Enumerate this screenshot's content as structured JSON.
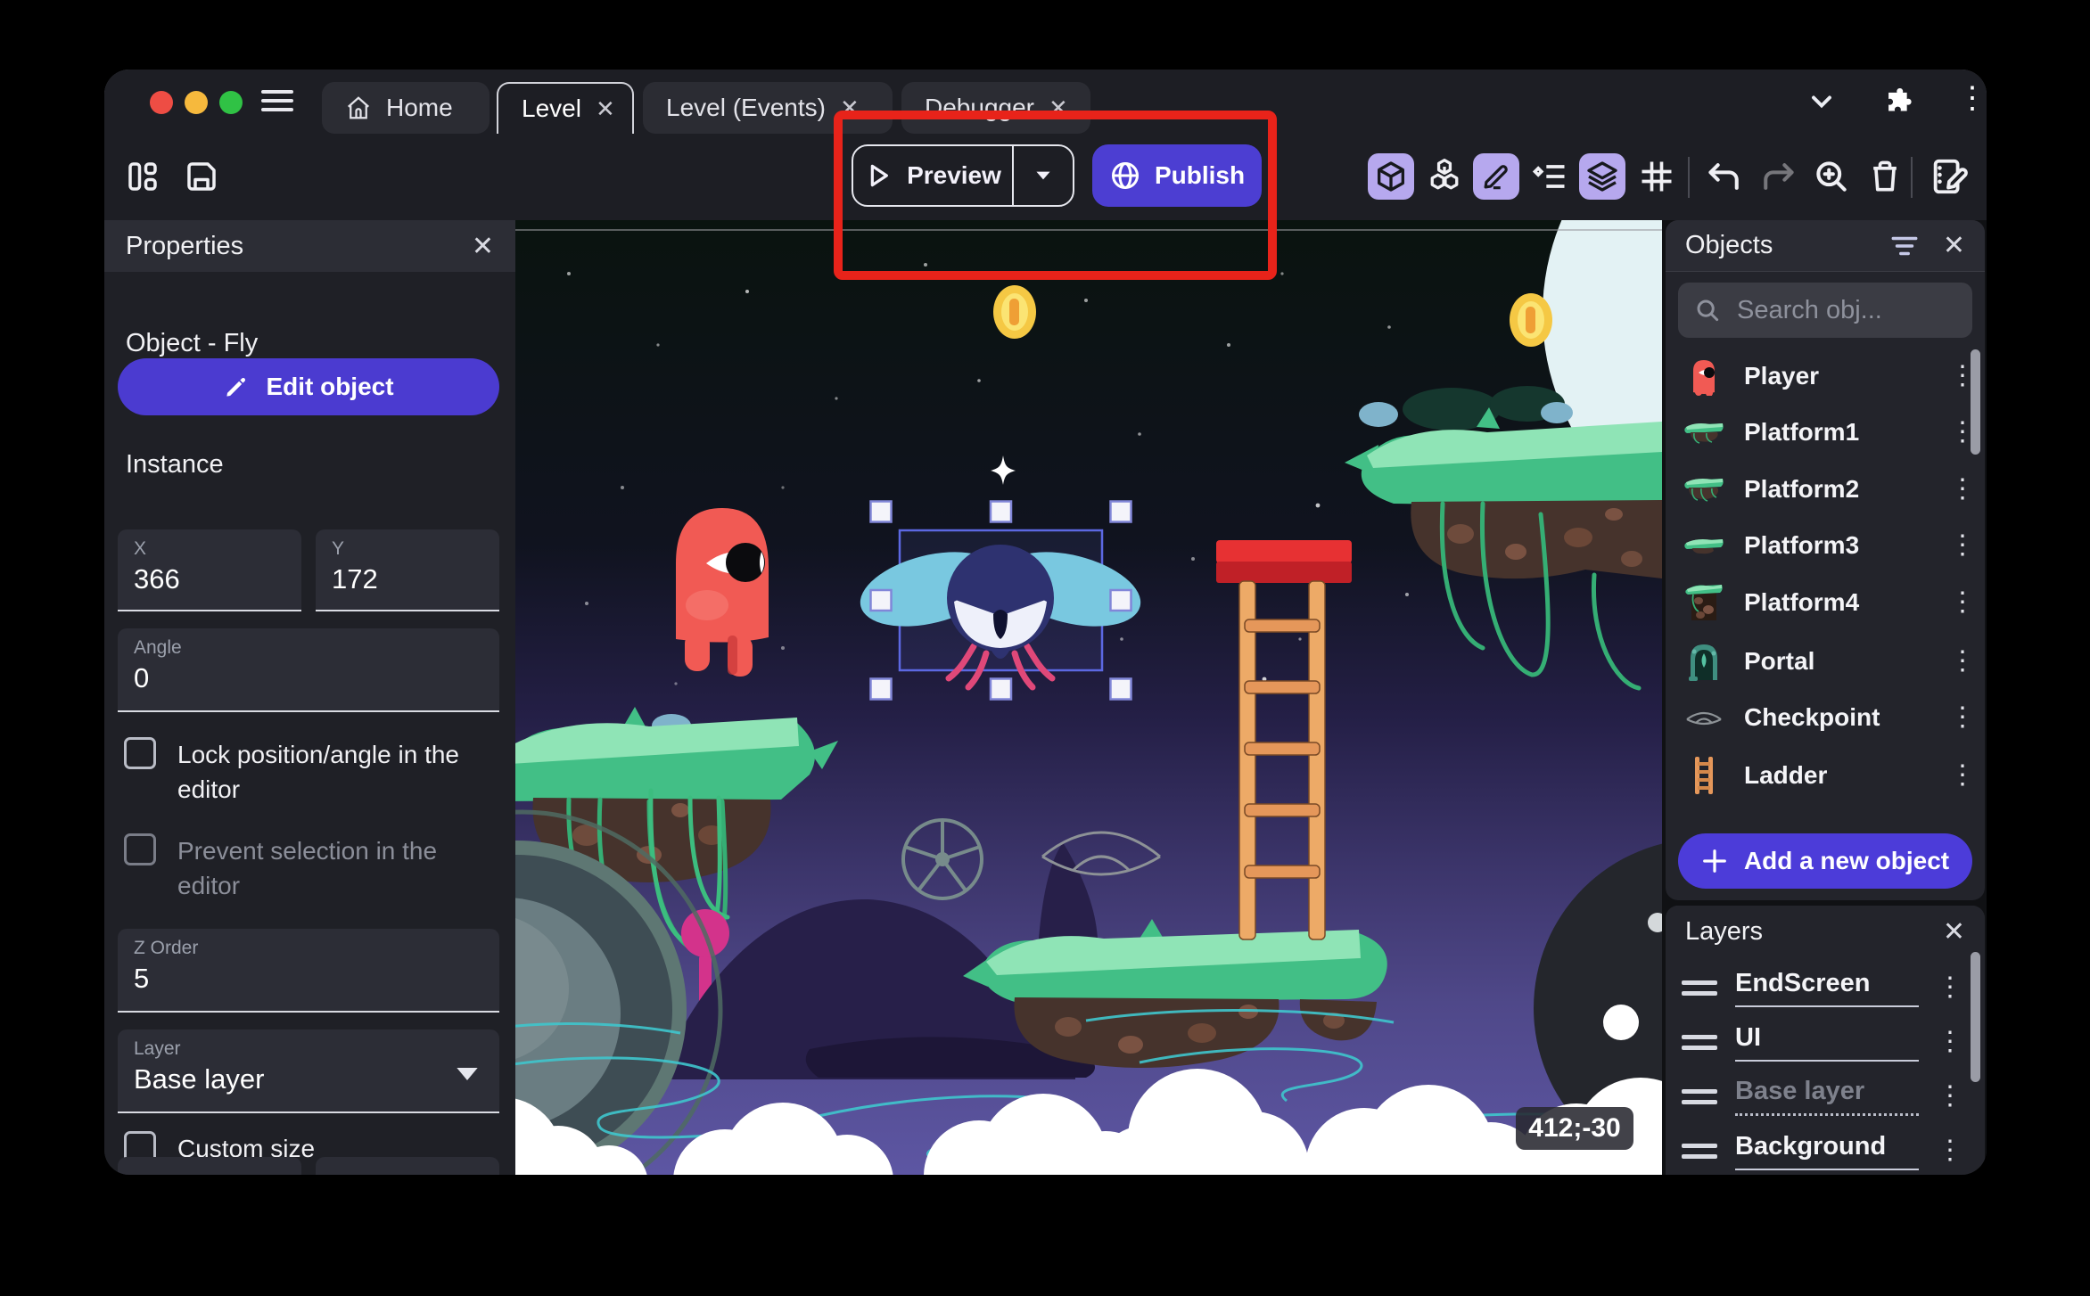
{
  "window": {
    "tabs": [
      {
        "label": "Home"
      },
      {
        "label": "Level"
      },
      {
        "label": "Level (Events)"
      },
      {
        "label": "Debugger"
      }
    ]
  },
  "toolbar": {
    "preview_label": "Preview",
    "publish_label": "Publish"
  },
  "properties": {
    "title": "Properties",
    "object_heading": "Object - Fly",
    "edit_object_label": "Edit object",
    "instance_heading": "Instance",
    "fields": {
      "x": {
        "label": "X",
        "value": "366"
      },
      "y": {
        "label": "Y",
        "value": "172"
      },
      "angle": {
        "label": "Angle",
        "value": "0"
      },
      "z_order": {
        "label": "Z Order",
        "value": "5"
      },
      "layer": {
        "label": "Layer",
        "value": "Base layer"
      }
    },
    "checkboxes": {
      "lock_label": "Lock position/angle in the editor",
      "prevent_label": "Prevent selection in the editor",
      "custom_size_label": "Custom size"
    }
  },
  "objects_panel": {
    "title": "Objects",
    "search_placeholder": "Search obj...",
    "items": [
      {
        "label": "Player",
        "icon": "player-sprite-icon"
      },
      {
        "label": "Platform1",
        "icon": "platform-sprite-icon"
      },
      {
        "label": "Platform2",
        "icon": "platform-sprite-icon"
      },
      {
        "label": "Platform3",
        "icon": "platform-sprite-icon"
      },
      {
        "label": "Platform4",
        "icon": "platform-tall-sprite-icon"
      },
      {
        "label": "Portal",
        "icon": "portal-sprite-icon"
      },
      {
        "label": "Checkpoint",
        "icon": "checkpoint-sprite-icon"
      },
      {
        "label": "Ladder",
        "icon": "ladder-sprite-icon"
      }
    ],
    "add_button_label": "Add a new object"
  },
  "layers_panel": {
    "title": "Layers",
    "items": [
      {
        "label": "EndScreen"
      },
      {
        "label": "UI"
      },
      {
        "label": "Base layer"
      },
      {
        "label": "Background"
      }
    ]
  },
  "canvas": {
    "cursor_coordinates": "412;-30",
    "selected_object": "Fly"
  },
  "colors": {
    "accent_purple": "#4c3ed2",
    "lavender_toggle": "#b6a8ee",
    "annotation_red": "#e8231a",
    "selection_blue": "#5c68e2",
    "traffic_red": "#ee4d44",
    "traffic_yellow": "#f6b93d",
    "traffic_green": "#30c245"
  }
}
